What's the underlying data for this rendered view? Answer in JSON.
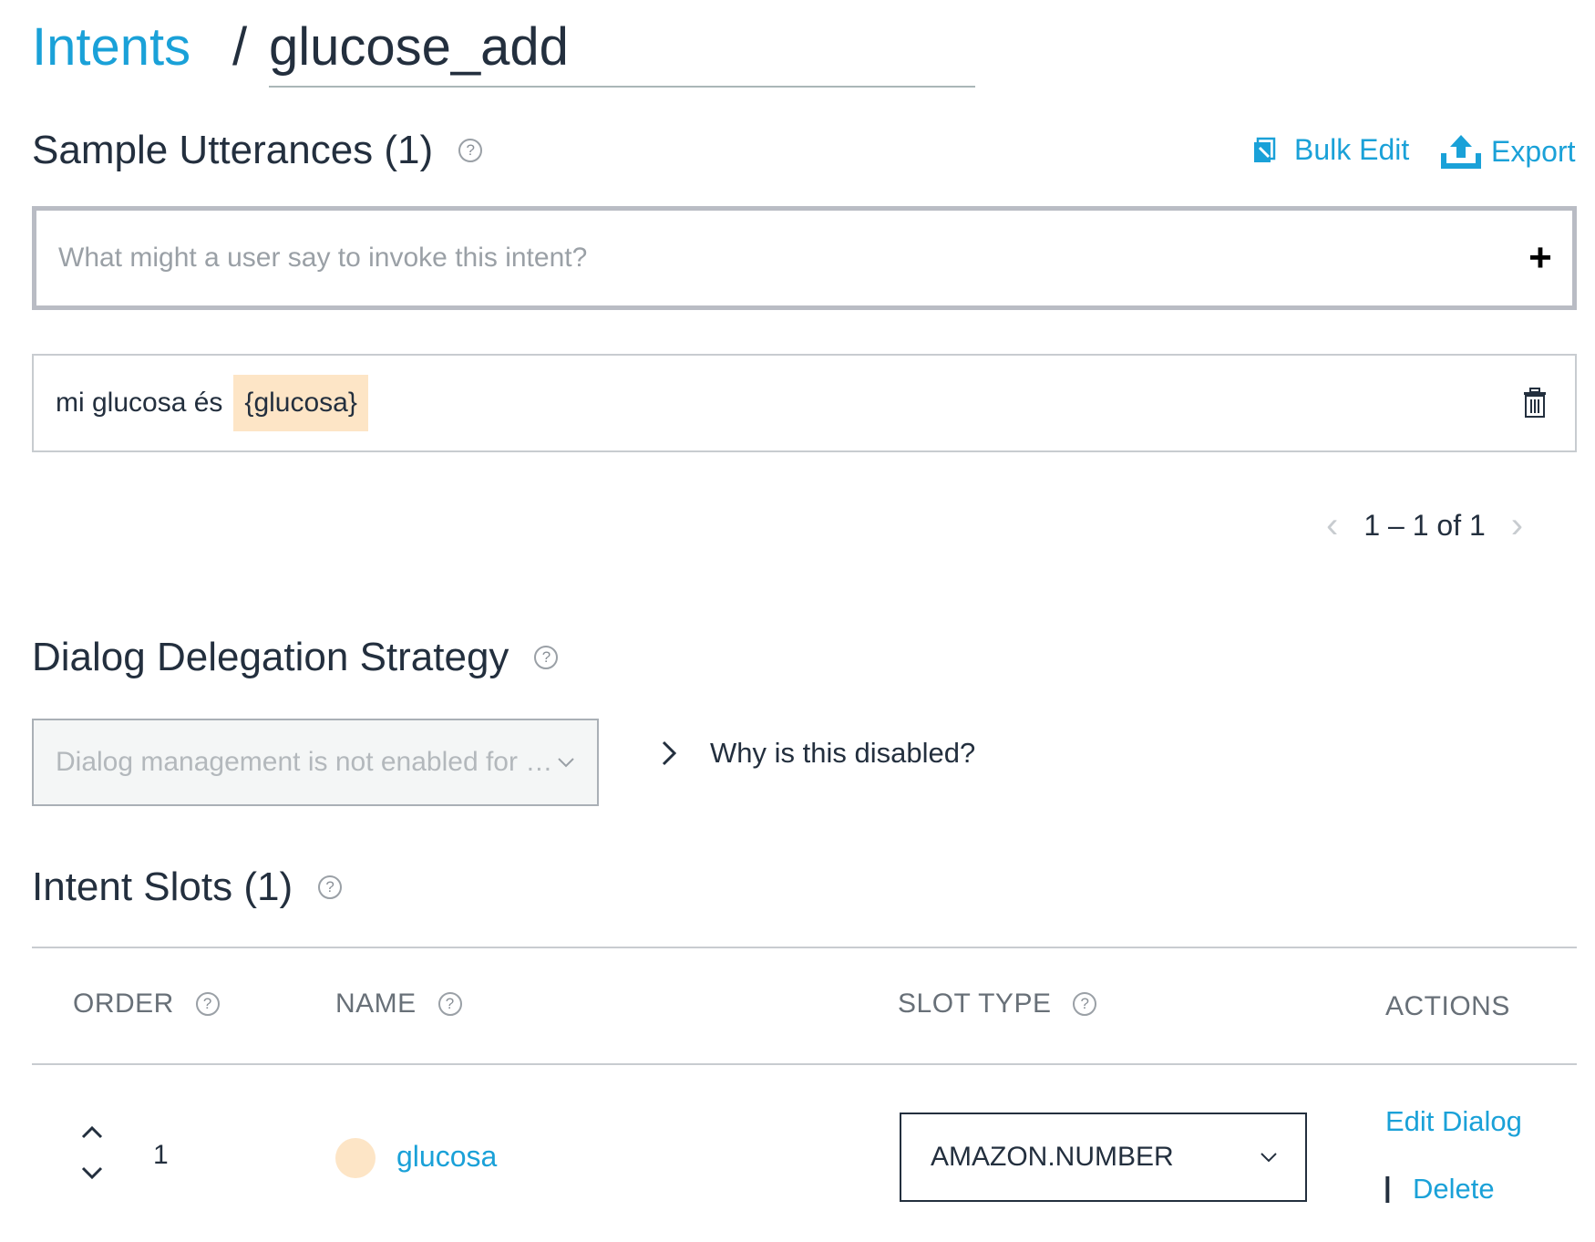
{
  "header": {
    "breadcrumb_root": "Intents",
    "separator": "/",
    "intent_name": "glucose_add"
  },
  "utterances": {
    "heading": "Sample Utterances (1)",
    "help": "?",
    "bulk_edit_label": "Bulk Edit",
    "export_label": "Export",
    "input_placeholder": "What might a user say to invoke this intent?",
    "add_symbol": "+",
    "items": [
      {
        "text": "mi glucosa és",
        "slot": "{glucosa}"
      }
    ],
    "pagination": {
      "range": "1 – 1 of 1"
    }
  },
  "dialog": {
    "heading": "Dialog Delegation Strategy",
    "help": "?",
    "select_value": "Dialog management is not enabled for this skill",
    "why_label": "Why is this disabled?"
  },
  "slots": {
    "heading": "Intent Slots (1)",
    "help": "?",
    "columns": {
      "order": "ORDER",
      "name": "NAME",
      "slot_type": "SLOT TYPE",
      "actions": "ACTIONS"
    },
    "rows": [
      {
        "order": "1",
        "name": "glucosa",
        "slot_type": "AMAZON.NUMBER",
        "action_edit_dialog": "Edit Dialog",
        "action_separator": "|",
        "action_delete": "Delete"
      }
    ]
  },
  "colors": {
    "accent": "#1aa1d8",
    "slot_highlight": "#fde5c6",
    "text": "#232f3e"
  }
}
